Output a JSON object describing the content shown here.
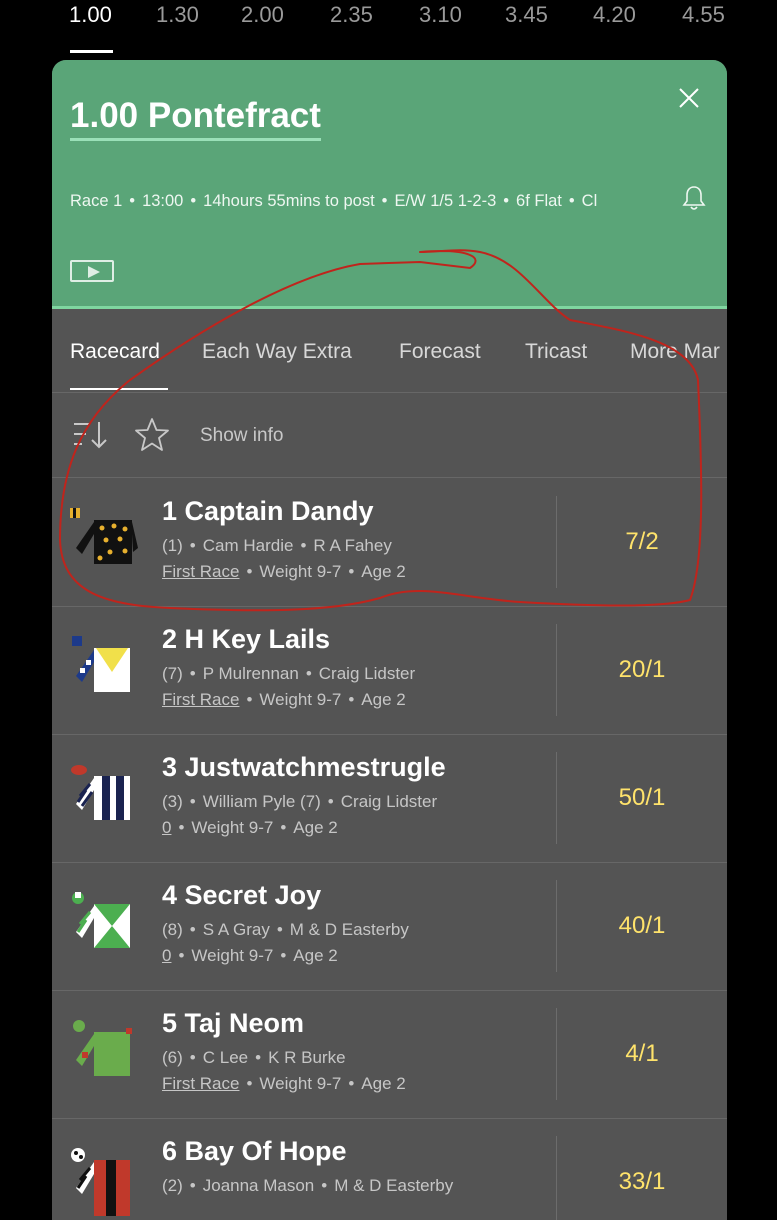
{
  "times": [
    "1.00",
    "1.30",
    "2.00",
    "2.35",
    "3.10",
    "3.45",
    "4.20",
    "4.55"
  ],
  "header": {
    "title": "1.00 Pontefract",
    "race_number": "Race 1",
    "time": "13:00",
    "countdown": "14hours 55mins to post",
    "ew_terms": "E/W 1/5 1-2-3",
    "distance": "6f Flat",
    "class_partial": "Cl"
  },
  "tabs": [
    "Racecard",
    "Each Way Extra",
    "Forecast",
    "Tricast",
    "More Mar"
  ],
  "tools": {
    "show_info": "Show info"
  },
  "runners": [
    {
      "name": "1  Captain Dandy",
      "draw": "(1)",
      "jockey": "Cam Hardie",
      "trainer": "R A Fahey",
      "form": "First Race",
      "weight": "Weight 9-7",
      "age": "Age 2",
      "odds": "7/2"
    },
    {
      "name": "2  H Key Lails",
      "draw": "(7)",
      "jockey": "P Mulrennan",
      "trainer": "Craig Lidster",
      "form": "First Race",
      "weight": "Weight 9-7",
      "age": "Age 2",
      "odds": "20/1"
    },
    {
      "name": "3  Justwatchmestrugle",
      "draw": "(3)",
      "jockey": "William Pyle (7)",
      "trainer": "Craig Lidster",
      "form": "0",
      "weight": "Weight 9-7",
      "age": "Age 2",
      "odds": "50/1"
    },
    {
      "name": "4  Secret Joy",
      "draw": "(8)",
      "jockey": "S A Gray",
      "trainer": "M & D Easterby",
      "form": "0",
      "weight": "Weight 9-7",
      "age": "Age 2",
      "odds": "40/1"
    },
    {
      "name": "5  Taj Neom",
      "draw": "(6)",
      "jockey": "C Lee",
      "trainer": "K R Burke",
      "form": "First Race",
      "weight": "Weight 9-7",
      "age": "Age 2",
      "odds": "4/1"
    },
    {
      "name": "6  Bay Of Hope",
      "draw": "(2)",
      "jockey": "Joanna Mason",
      "trainer": "M & D Easterby",
      "form": "",
      "weight": "",
      "age": "",
      "odds": "33/1"
    }
  ],
  "colors": {
    "header_green": "#5aa578",
    "odds_yellow": "#ffe36b",
    "panel_grey": "#545454",
    "annotation_red": "#c0241c"
  },
  "icons": [
    "close-icon",
    "bell-icon",
    "video-icon",
    "sort-icon",
    "star-icon"
  ]
}
